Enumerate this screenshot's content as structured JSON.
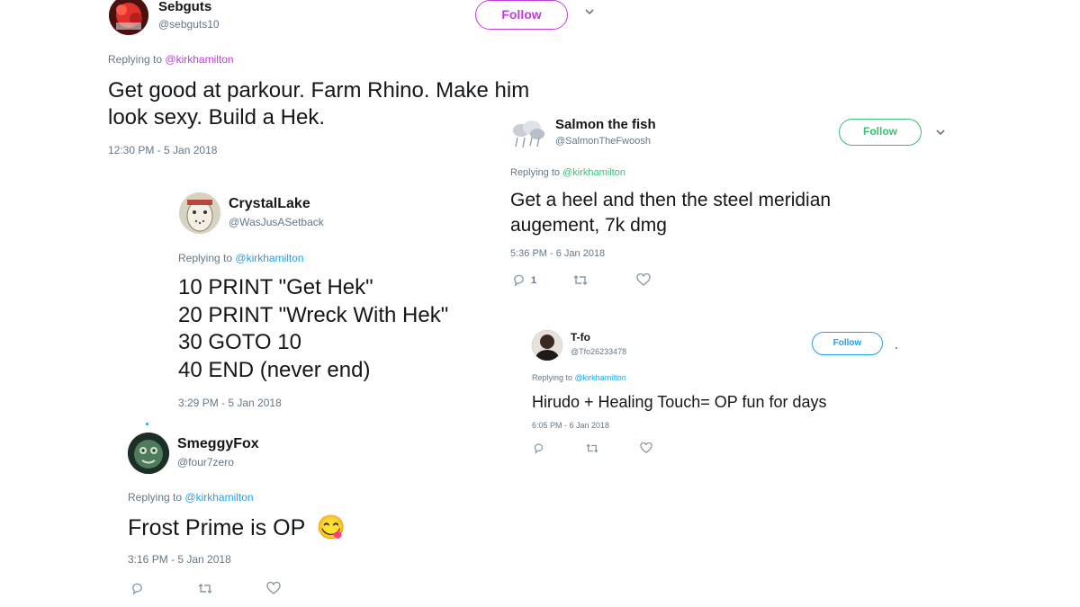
{
  "colors": {
    "purple_accent": "#c13ce0",
    "green_accent": "#3bbf7a",
    "blue_accent": "#1da1f2",
    "secondary_text": "#657786",
    "icon_grey": "#8899a6"
  },
  "tweets": [
    {
      "name": "Sebguts",
      "handle": "@sebguts10",
      "replying_label": "Replying to",
      "replying_to": "@kirkhamilton",
      "text_lines": [
        "Get good at parkour. Farm Rhino. Make him",
        "look sexy. Build a Hek."
      ],
      "timestamp": "12:30 PM - 5 Jan 2018",
      "follow_label": "Follow",
      "avatar_icon": "red-character-avatar"
    },
    {
      "name": "Salmon the fish",
      "handle": "@SalmonTheFwoosh",
      "replying_label": "Replying to",
      "replying_to": "@kirkhamilton",
      "text_lines": [
        "Get a heel and then the steel meridian",
        "augement, 7k dmg"
      ],
      "timestamp": "5:36 PM - 6 Jan 2018",
      "follow_label": "Follow",
      "reply_count": "1",
      "avatar_icon": "cloud-avatar"
    },
    {
      "name": "CrystalLake",
      "handle": "@WasJusASetback",
      "replying_label": "Replying to",
      "replying_to": "@kirkhamilton",
      "text_lines": [
        "10 PRINT \"Get Hek\"",
        "20 PRINT \"Wreck With Hek\"",
        "30 GOTO 10",
        "40 END (never end)"
      ],
      "timestamp": "3:29 PM - 5 Jan 2018",
      "avatar_icon": "hockey-mask-avatar"
    },
    {
      "name": "T-fo",
      "handle": "@Tfo26233478",
      "replying_label": "Replying to",
      "replying_to": "@kirkhamilton",
      "text_lines": [
        "Hirudo + Healing Touch= OP fun for days"
      ],
      "timestamp": "6:05 PM - 6 Jan 2018",
      "follow_label": "Follow",
      "avatar_icon": "person-avatar"
    },
    {
      "name": "SmeggyFox",
      "handle": "@four7zero",
      "replying_label": "Replying to",
      "replying_to": "@kirkhamilton",
      "text_lines": [
        "Frost Prime is OP"
      ],
      "emoji": "😋",
      "timestamp": "3:16 PM - 5 Jan 2018",
      "avatar_icon": "fox-avatar"
    }
  ]
}
